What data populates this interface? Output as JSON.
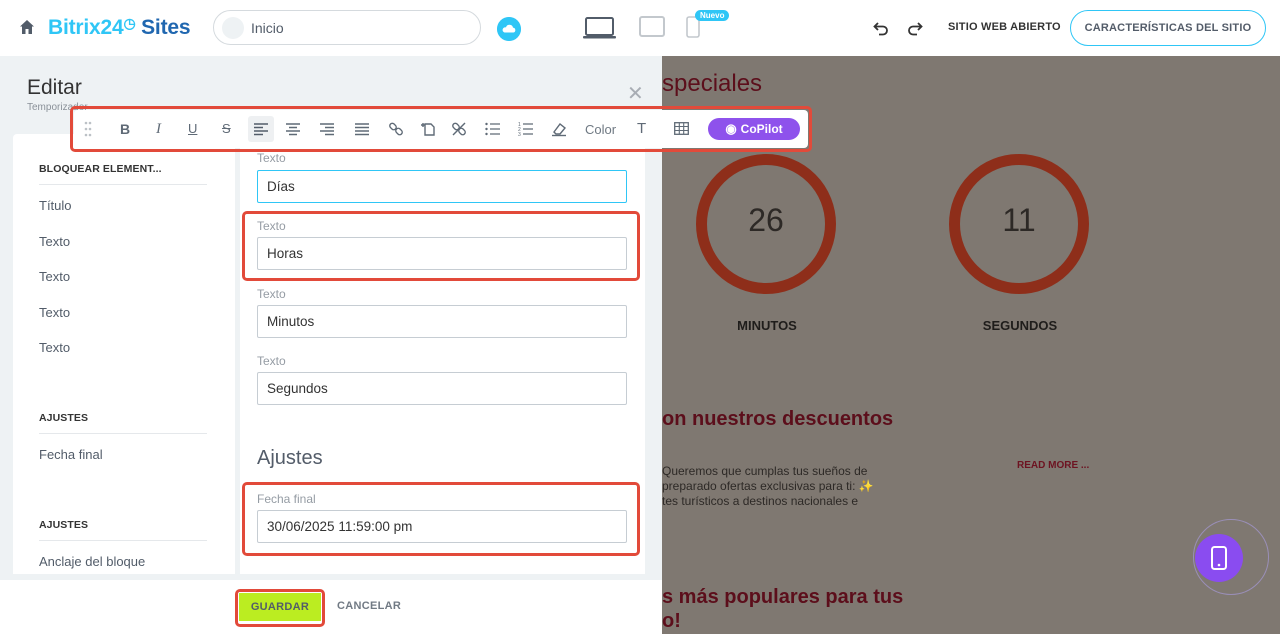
{
  "topbar": {
    "logo_brand": "Bitrix24",
    "logo_suffix": "Sites",
    "page_selector": "Inicio",
    "new_badge": "Nuevo",
    "open_site": "SITIO WEB ABIERTO",
    "features_button": "CARACTERÍSTICAS DEL SITIO"
  },
  "editor": {
    "title": "Editar",
    "subtitle": "Temporizador",
    "sidebar": {
      "section1": "BLOQUEAR ELEMENT...",
      "items": [
        "Título",
        "Texto",
        "Texto",
        "Texto",
        "Texto"
      ],
      "section2": "AJUSTES",
      "item_fecha": "Fecha final",
      "section3": "AJUSTES",
      "item_anclaje": "Anclaje del bloque"
    },
    "fields": [
      {
        "label": "Texto",
        "value": "Días"
      },
      {
        "label": "Texto",
        "value": "Horas"
      },
      {
        "label": "Texto",
        "value": "Minutos"
      },
      {
        "label": "Texto",
        "value": "Segundos"
      }
    ],
    "ajustes_heading": "Ajustes",
    "fecha_label": "Fecha final",
    "fecha_value": "30/06/2025 11:59:00 pm"
  },
  "toolbar": {
    "bold": "B",
    "italic": "I",
    "underline": "U",
    "strike": "S",
    "color": "Color",
    "text_format": "T",
    "copilot": "CoPilot"
  },
  "bottom": {
    "save": "GUARDAR",
    "cancel": "CANCELAR"
  },
  "preview": {
    "heading1": "speciales",
    "minutes_value": "26",
    "minutes_label": "MINUTOS",
    "seconds_value": "11",
    "seconds_label": "SEGUNDOS",
    "heading2": "on nuestros descuentos",
    "body_line1": "Queremos que cumplas tus sueños de",
    "body_line2": "preparado ofertas exclusivas para ti: ✨",
    "body_line3": "tes turísticos a destinos nacionales e",
    "read_more": "READ MORE ...",
    "heading3a": "s más populares para tus",
    "heading3b": "o!"
  },
  "colors": {
    "accent": "#2fc6f6",
    "highlight": "#e24a3a",
    "save_green": "#bbed21",
    "copilot_purple": "#8e52ec"
  }
}
